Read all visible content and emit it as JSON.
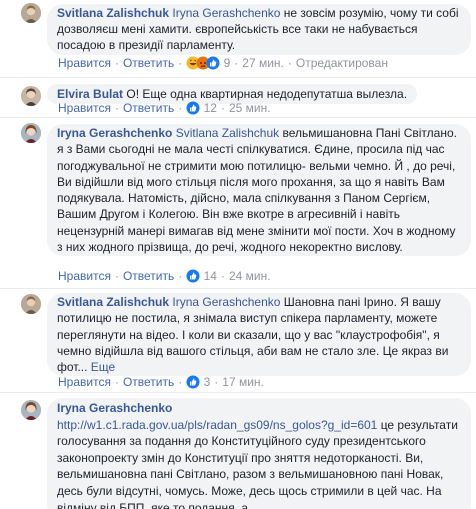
{
  "comments": [
    {
      "author": "Svitlana Zalishchuk",
      "mention": "Iryna Gerashchenko",
      "text": "не зовсім розумію, чому ти собі дозволяєш мені хамити. європейськість все таки не набувається посадою в президії парламенту.",
      "actions": {
        "like": "Нравится",
        "reply": "Ответить",
        "reactions_count": "9",
        "time": "27 мин.",
        "edited": "Отредактирован"
      }
    },
    {
      "author": "Elvira Bulat",
      "text": "О! Еще одна квартирная недодепутатша вылезла.",
      "actions": {
        "like": "Нравится",
        "reply": "Ответить",
        "reactions_count": "12",
        "time": "25 мин."
      }
    },
    {
      "author": "Iryna Gerashchenko",
      "mention": "Svitlana Zalishchuk",
      "text": "вельмишановна Пані Світлано. я з Вами сьогодні не мала честі спілкуватися. Єдине, просила під час погоджувальної не стримити мою потилицю- вельми чемно. Й , до речі, Ви відійшли від мого стільця після мого прохання, за що я навіть Вам подякувала. Натомість, дійсно, мала спілкування з Паном Сергієм, Вашим Другом і Колегою. Він вже вкотре в агресивній і навіть нецензурній манері вимагав від мене змінити мої пости. Хоч в жодному з них жодного прізвища, до речі, жодного некоректно вислову.",
      "actions": {
        "like": "Нравится",
        "reply": "Ответить",
        "reactions_count": "14",
        "time": "24 мин."
      }
    },
    {
      "author": "Svitlana Zalishchuk",
      "mention": "Iryna Gerashchenko",
      "text": "Шановна пані Ірино. Я вашу потилицю не постила, я знімала виступ спікера парламенту, можете переглянути на відео. І коли ви сказали, що у вас \"клаустрофобія\", я чемно відійшла від вашого стільця, аби вам не стало зле. Це якраз ви фот...",
      "more": "Еще",
      "actions": {
        "like": "Нравится",
        "reply": "Ответить",
        "reactions_count": "3",
        "time": "17 мин."
      }
    },
    {
      "author": "Iryna Gerashchenko",
      "link": "http://w1.c1.rada.gov.ua/pls/radan_gs09/ns_golos?g_id=601",
      "text": "це результати голосування за подання до Конституційного суду президентського законопроекту змін до Конституції про зняття недоторканості. Ви, вельмишановна пані Світлано, разом з вельмишановною пані Новак, десь були відсутні, чомусь. Може, десь щось стримили в цей час. На відміну від БПП, яке то подання, а"
    }
  ],
  "colors": {
    "link": "#385898",
    "bubble": "#f2f3f5",
    "meta": "#90949c",
    "like_blue": "#4267b2"
  }
}
